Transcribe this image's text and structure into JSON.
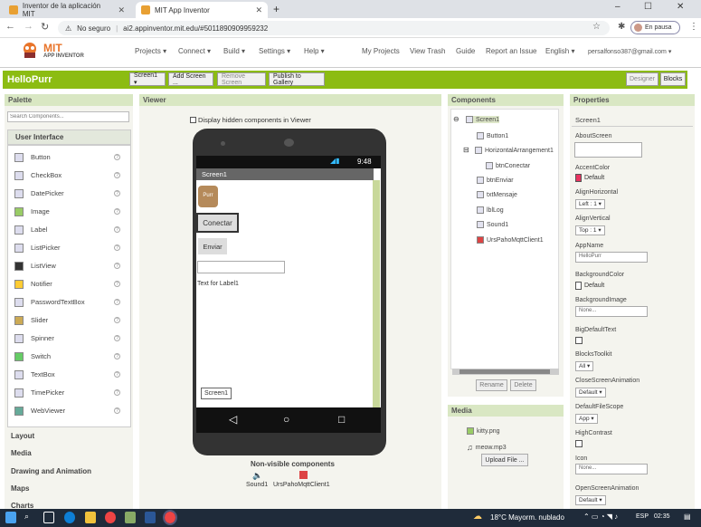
{
  "browser": {
    "tabs": [
      {
        "title": "Inventor de la aplicación MIT"
      },
      {
        "title": "MIT App Inventor"
      }
    ],
    "new_tab": "+",
    "window_controls": [
      "–",
      "☐",
      "✕"
    ],
    "security": "No seguro",
    "url": "ai2.appinventor.mit.edu/#5011890909959232",
    "profile": "En pausa"
  },
  "app_header": {
    "logo_title": "MIT",
    "logo_sub": "APP INVENTOR",
    "menus": [
      "Projects ▾",
      "Connect ▾",
      "Build ▾",
      "Settings ▾",
      "Help ▾"
    ],
    "right_links": [
      "My Projects",
      "View Trash",
      "Guide",
      "Report an Issue",
      "English ▾",
      "persalfonso387@gmail.com ▾"
    ]
  },
  "toolbar": {
    "project_name": "HelloPurr",
    "screen_select": "Screen1 ▾",
    "add_screen": "Add Screen ...",
    "remove_screen": "Remove Screen",
    "publish": "Publish to Gallery",
    "designer": "Designer",
    "blocks": "Blocks"
  },
  "palette": {
    "title": "Palette",
    "search_placeholder": "Search Components...",
    "category": "User Interface",
    "items": [
      "Button",
      "CheckBox",
      "DatePicker",
      "Image",
      "Label",
      "ListPicker",
      "ListView",
      "Notifier",
      "PasswordTextBox",
      "Slider",
      "Spinner",
      "Switch",
      "TextBox",
      "TimePicker",
      "WebViewer"
    ],
    "help": "?",
    "other_categories": [
      "Layout",
      "Media",
      "Drawing and Animation",
      "Maps",
      "Charts"
    ]
  },
  "viewer": {
    "title": "Viewer",
    "hidden_label": "Display hidden components in Viewer",
    "status_time": "9:48",
    "screen_title": "Screen1",
    "kitty_alt": "Purr",
    "btn_conectar": "Conectar",
    "btn_enviar": "Enviar",
    "label_text": "Text for Label1",
    "bottom_button": "Screen1",
    "nav_back": "◁",
    "nav_home": "○",
    "nav_recent": "□",
    "nonvisible_title": "Non-visible components",
    "nonvisible": [
      "Sound1",
      "UrsPahoMqttClient1"
    ]
  },
  "components": {
    "title": "Components",
    "tree": [
      {
        "label": "Screen1",
        "toggle": "⊖"
      },
      {
        "label": "Button1"
      },
      {
        "label": "HorizontalArrangement1",
        "toggle": "⊟"
      },
      {
        "label": "btnConectar"
      },
      {
        "label": "btnEnviar"
      },
      {
        "label": "txtMensaje"
      },
      {
        "label": "lblLog"
      },
      {
        "label": "Sound1"
      },
      {
        "label": "UrsPahoMqttClient1"
      }
    ],
    "rename": "Rename",
    "delete": "Delete"
  },
  "media": {
    "title": "Media",
    "files": [
      "kitty.png",
      "meow.mp3"
    ],
    "upload": "Upload File ..."
  },
  "properties": {
    "title": "Properties",
    "component": "Screen1",
    "about_label": "AboutScreen",
    "accent_label": "AccentColor",
    "accent_value": "Default",
    "accent_color": "#e8335f",
    "align_h_label": "AlignHorizontal",
    "align_h_value": "Left : 1 ▾",
    "align_v_label": "AlignVertical",
    "align_v_value": "Top : 1 ▾",
    "appname_label": "AppName",
    "appname_value": "HelloPurr",
    "bgcolor_label": "BackgroundColor",
    "bgcolor_value": "Default",
    "bgimage_label": "BackgroundImage",
    "bgimage_value": "None...",
    "bigtext_label": "BigDefaultText",
    "blocks_label": "BlocksToolkit",
    "blocks_value": "All ▾",
    "closeanim_label": "CloseScreenAnimation",
    "closeanim_value": "Default ▾",
    "filescope_label": "DefaultFileScope",
    "filescope_value": "App ▾",
    "contrast_label": "HighContrast",
    "icon_label": "Icon",
    "icon_value": "None...",
    "openanim_label": "OpenScreenAnimation",
    "openanim_value": "Default ▾"
  },
  "taskbar": {
    "weather": "18°C Mayorm. nublado",
    "lang": "ESP",
    "time": "02:35"
  },
  "colors": {
    "green": "#8cbc12",
    "header_bg": "#d9e7c3",
    "accent": "#e8335f"
  }
}
